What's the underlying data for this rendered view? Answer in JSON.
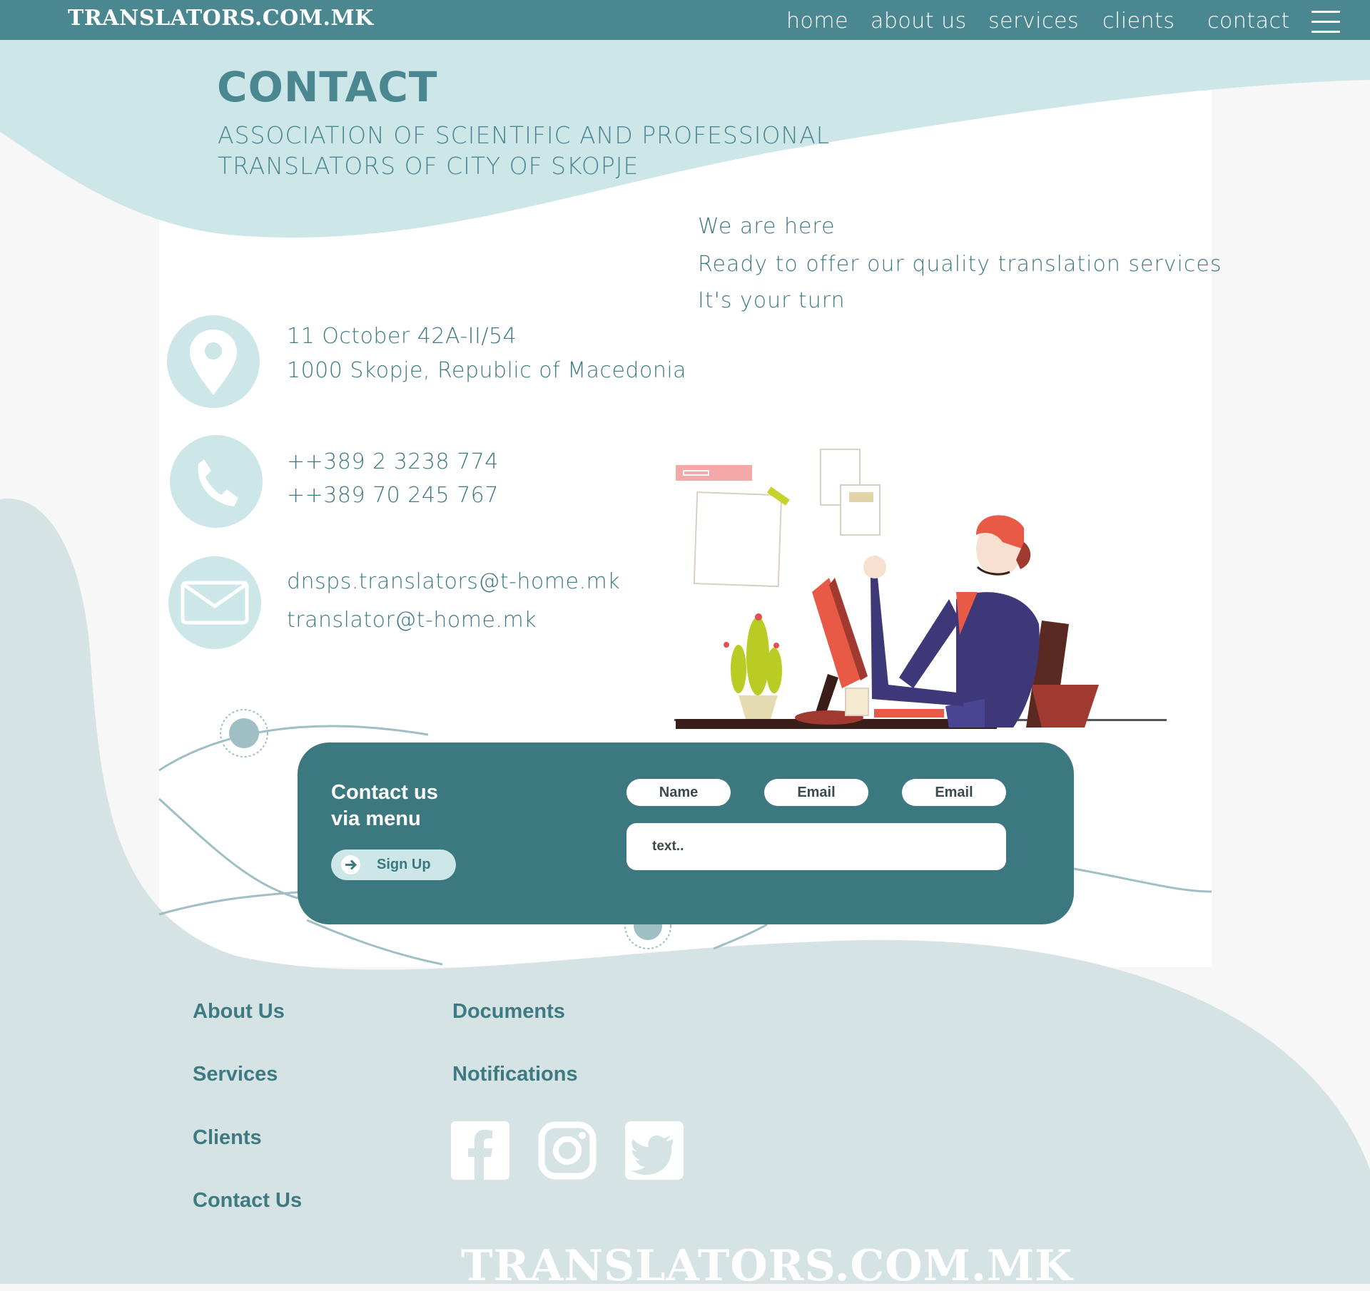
{
  "header": {
    "logo": "TRANSLATORS.COM.MK",
    "nav": {
      "home": "home",
      "about": "about us",
      "services": "services",
      "clients": "clients",
      "contact": "contact"
    },
    "menu_icon": "hamburger-menu-icon"
  },
  "hero": {
    "title": "CONTACT",
    "subtitle_line1": "ASSOCIATION OF SCIENTIFIC AND PROFESSIONAL",
    "subtitle_line2": "TRANSLATORS OF CITY OF SKOPJE"
  },
  "tagline": {
    "line1": "We are here",
    "line2": "Ready to offer our quality translation services",
    "line3": "It's your turn"
  },
  "contact_info": {
    "address_line1": "11 October 42A-II/54",
    "address_line2": "1000 Skopje, Republic of Macedonia",
    "phone1": "++389 2 3238 774",
    "phone2": "++389 70 245 767",
    "email1": "dnsps.translators@t-home.mk",
    "email2": "translator@t-home.mk",
    "icons": [
      "location-pin-icon",
      "phone-icon",
      "envelope-icon"
    ]
  },
  "form": {
    "heading_line1": "Contact us",
    "heading_line2": "via menu",
    "signup_label": "Sign Up",
    "field_name": "Name",
    "field_email1": "Email",
    "field_email2": "Email",
    "message_placeholder": "text.."
  },
  "footer": {
    "links_col1": [
      "About Us",
      "Services",
      "Clients",
      "Contact Us"
    ],
    "links_col2": [
      "Documents",
      "Notifications"
    ],
    "social": [
      "facebook-icon",
      "instagram-icon",
      "twitter-icon"
    ],
    "logo": "TRANSLATORS.COM.MK"
  },
  "colors": {
    "header": "#4b8790",
    "light_accent": "#cde6e8",
    "panel": "#3c7880",
    "footer_bg": "#d5e3e4",
    "text_teal": "#3e7a82"
  }
}
